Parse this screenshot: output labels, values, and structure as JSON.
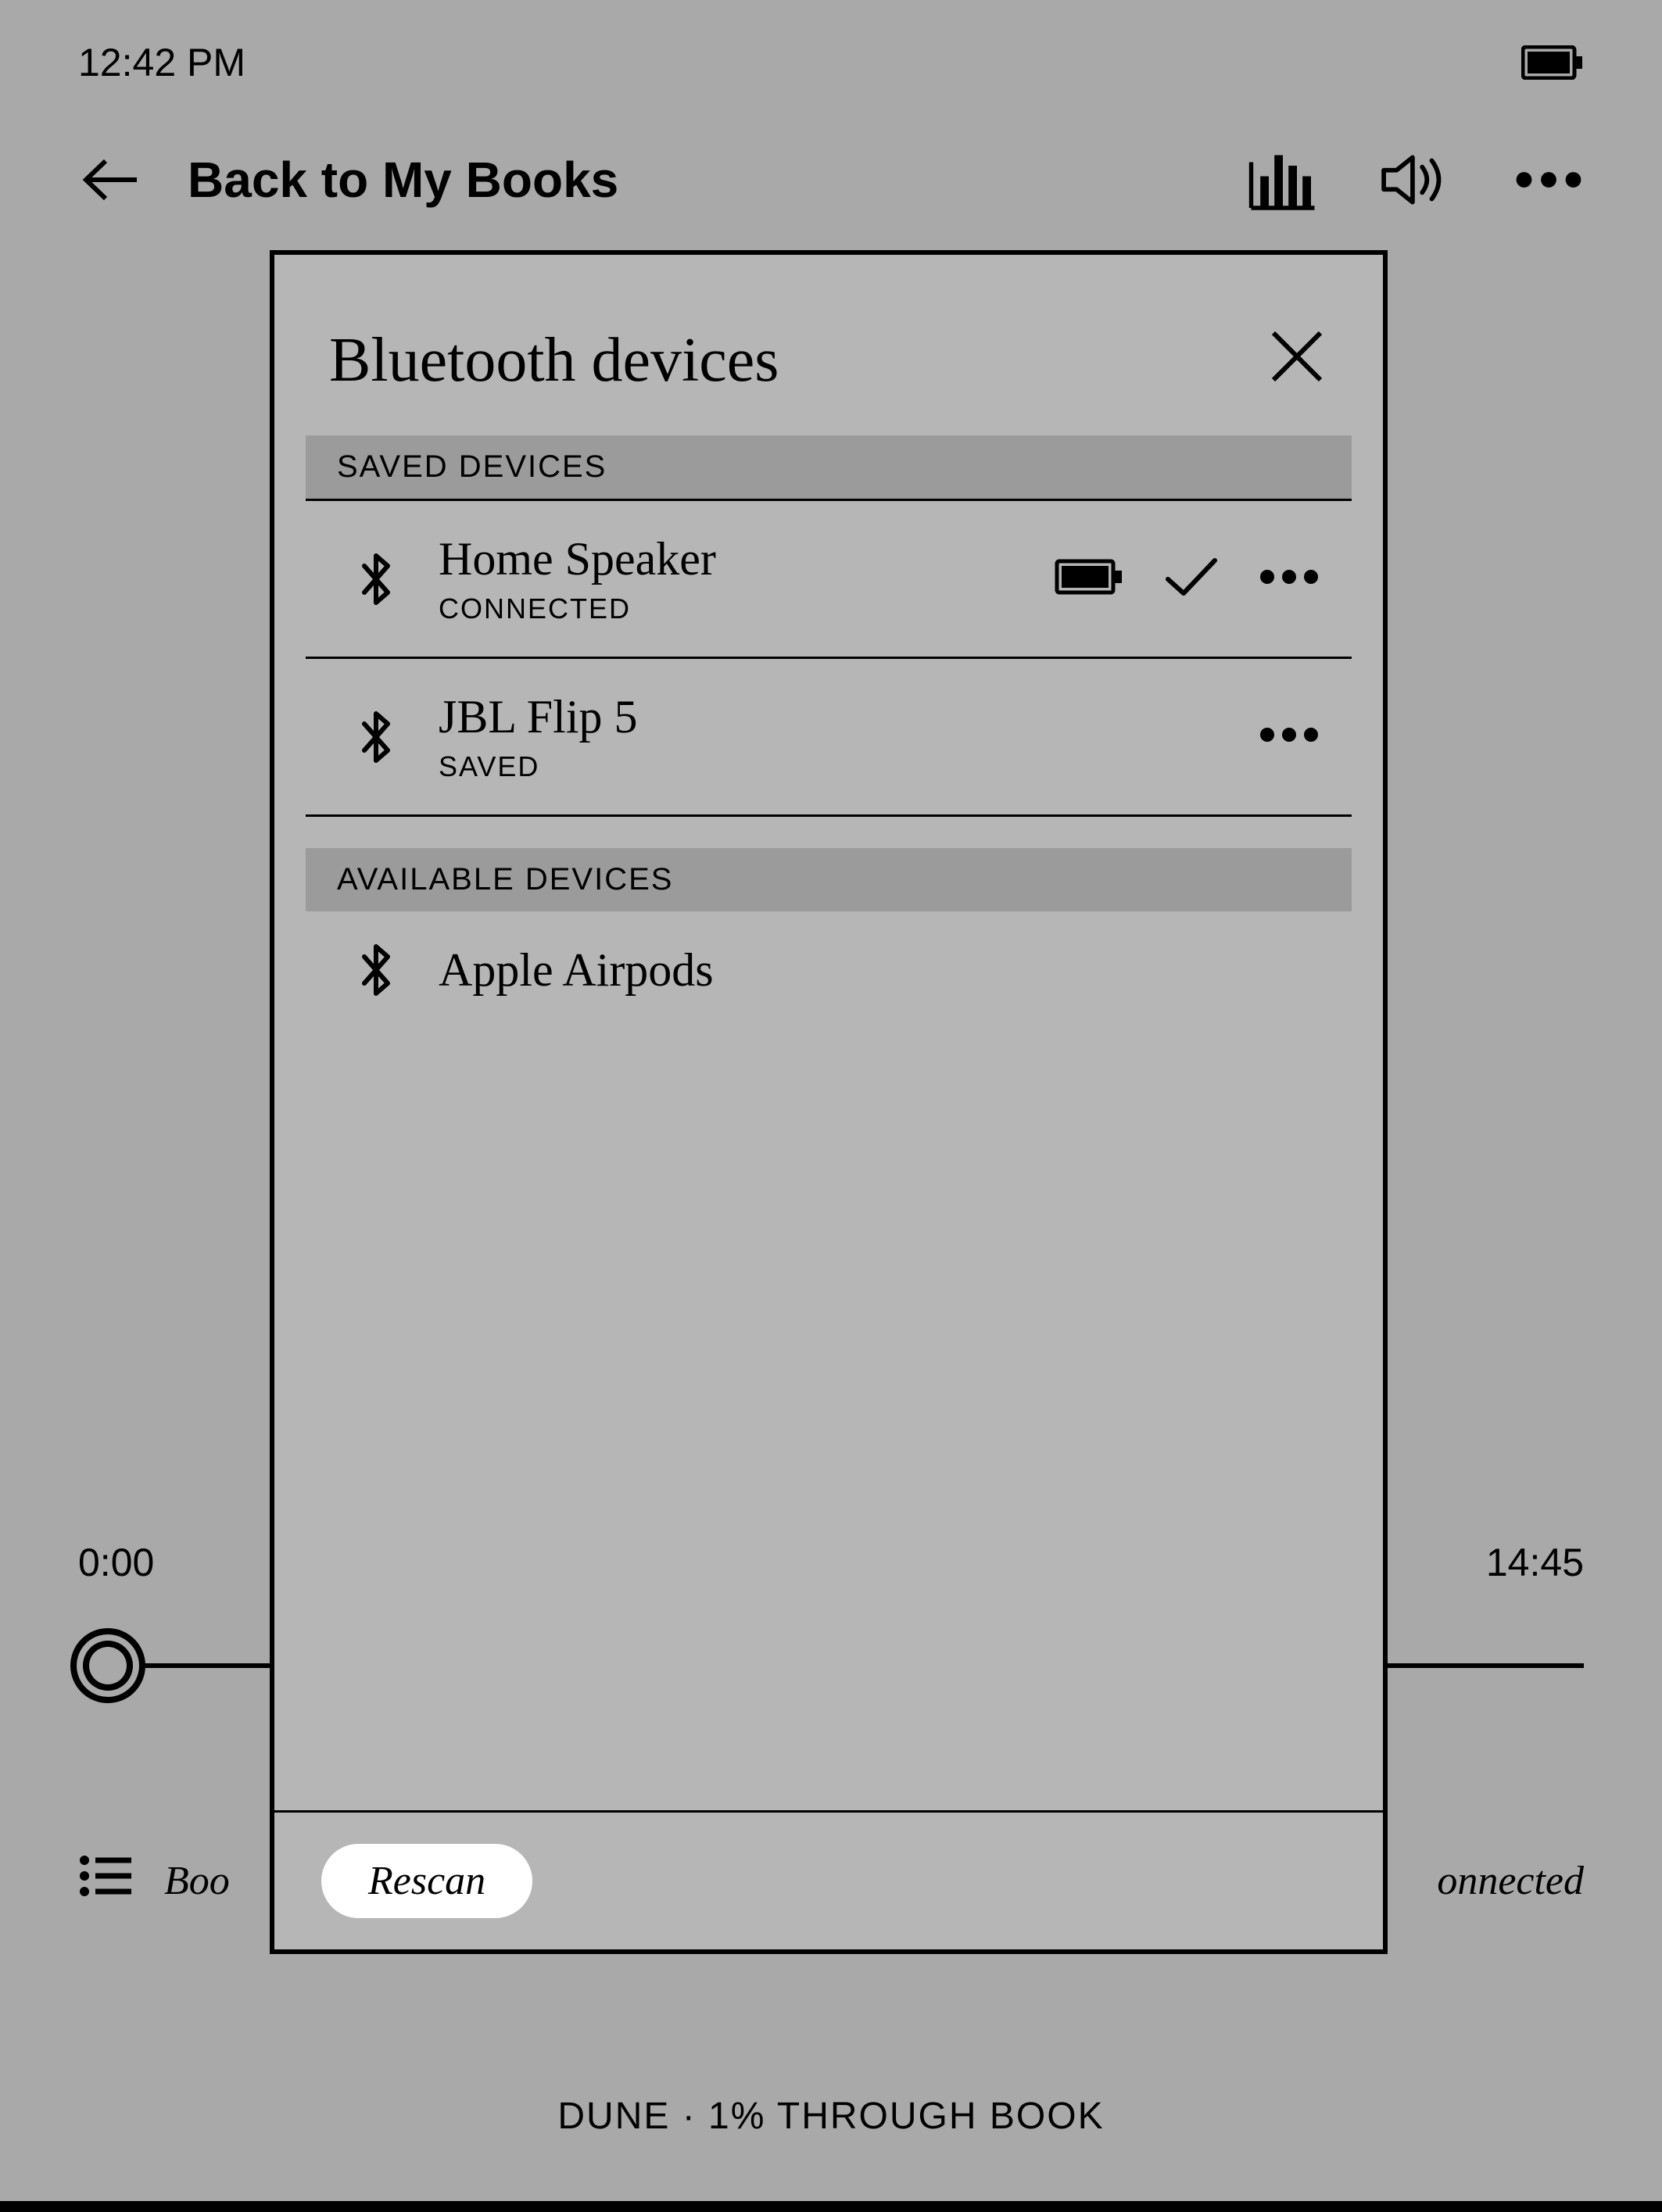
{
  "status": {
    "time": "12:42 PM"
  },
  "nav": {
    "back_label": "Back to My Books"
  },
  "player": {
    "elapsed": "0:00",
    "remaining": "14:45",
    "bottom_left_text": "Boo",
    "bottom_right_text": "onnected"
  },
  "footer": {
    "line": "DUNE · 1% THROUGH BOOK"
  },
  "dialog": {
    "title": "Bluetooth devices",
    "saved_header": "SAVED DEVICES",
    "available_header": "AVAILABLE DEVICES",
    "rescan_label": "Rescan",
    "saved": [
      {
        "name": "Home Speaker",
        "status": "CONNECTED",
        "show_battery": true,
        "show_check": true
      },
      {
        "name": "JBL Flip 5",
        "status": "SAVED",
        "show_battery": false,
        "show_check": false
      }
    ],
    "available": [
      {
        "name": "Apple Airpods"
      }
    ]
  }
}
